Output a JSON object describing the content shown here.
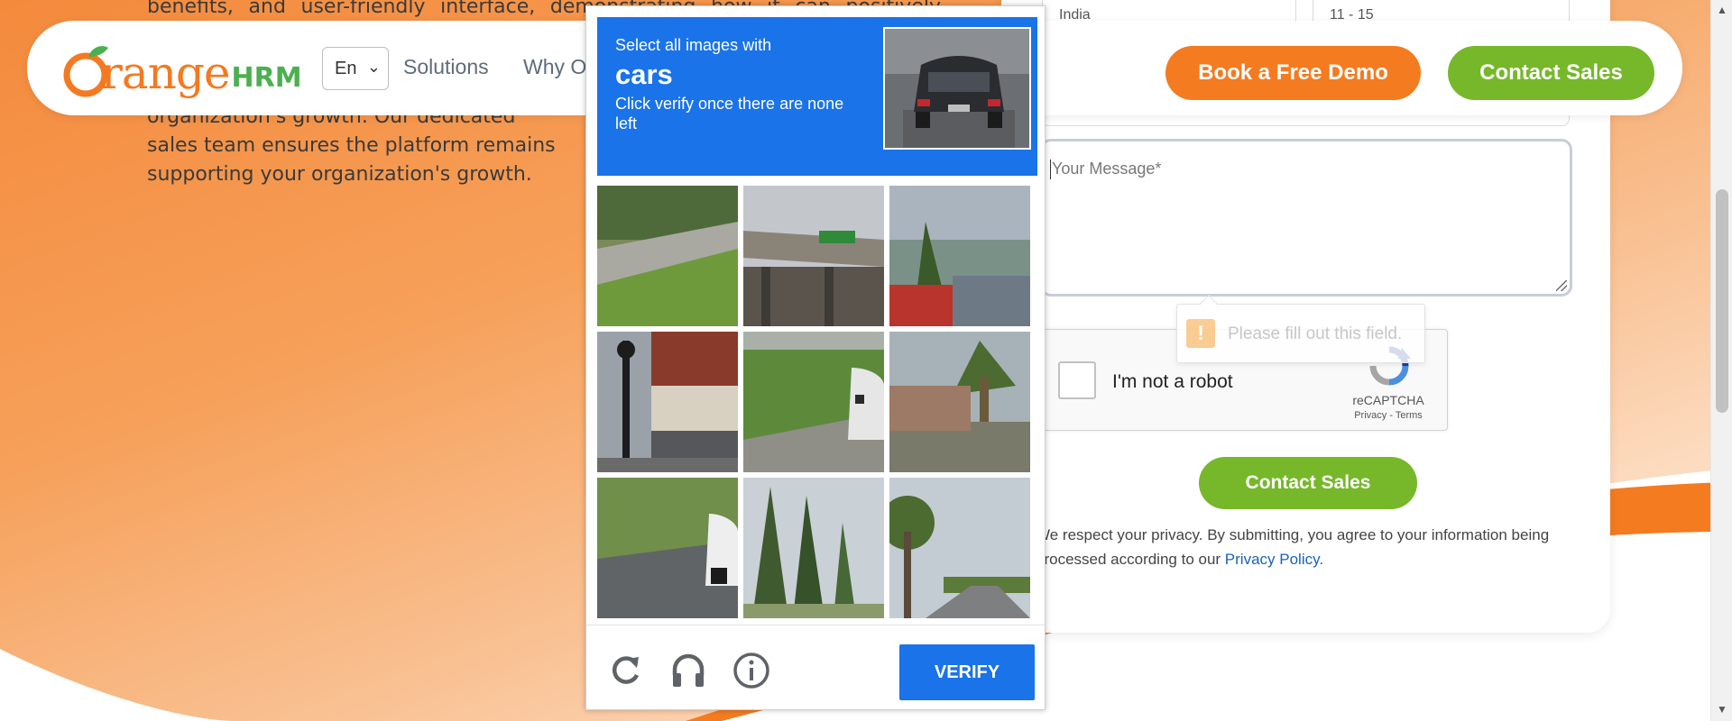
{
  "hero": {
    "line_top": "benefits, and user-friendly interface, demonstrating how it can positively impact",
    "line_mid": "organization's growth. Our dedicated",
    "line_a": "sales team ensures the platform remains",
    "line_b": "supporting your organization's growth."
  },
  "header": {
    "logo_word": "range",
    "logo_hrm": "HRM",
    "language": "En",
    "nav": [
      "Solutions",
      "Why O"
    ],
    "demo_button": "Book a Free Demo",
    "sales_button": "Contact Sales"
  },
  "form": {
    "select_left": "India",
    "select_right": "11 - 15",
    "message_placeholder": "Your Message*",
    "validation_tooltip": "Please fill out this field.",
    "recaptcha": {
      "label": "I'm not a robot",
      "brand": "reCAPTCHA",
      "links": "Privacy - Terms"
    },
    "submit_button": "Contact Sales",
    "privacy_text": "We respect your privacy. By submitting, you agree to your information being processed according to our",
    "privacy_link": "Privacy Policy."
  },
  "challenge": {
    "instruction": "Select all images with",
    "target_word": "cars",
    "subtext": "Click verify once there are none left",
    "tiles": [
      "tile-road-grass",
      "tile-overpass-sign",
      "tile-fence-palm",
      "tile-lamp-building",
      "tile-grass-car",
      "tile-palm-sky",
      "tile-bush-car",
      "tile-cypress-trees",
      "tile-road-trees"
    ],
    "icons": [
      "reload-icon",
      "headphones-icon",
      "info-icon"
    ],
    "verify_button": "VERIFY"
  },
  "colors": {
    "brand_orange": "#f47b20",
    "brand_green": "#76b82a",
    "captcha_blue": "#1a73e8"
  }
}
